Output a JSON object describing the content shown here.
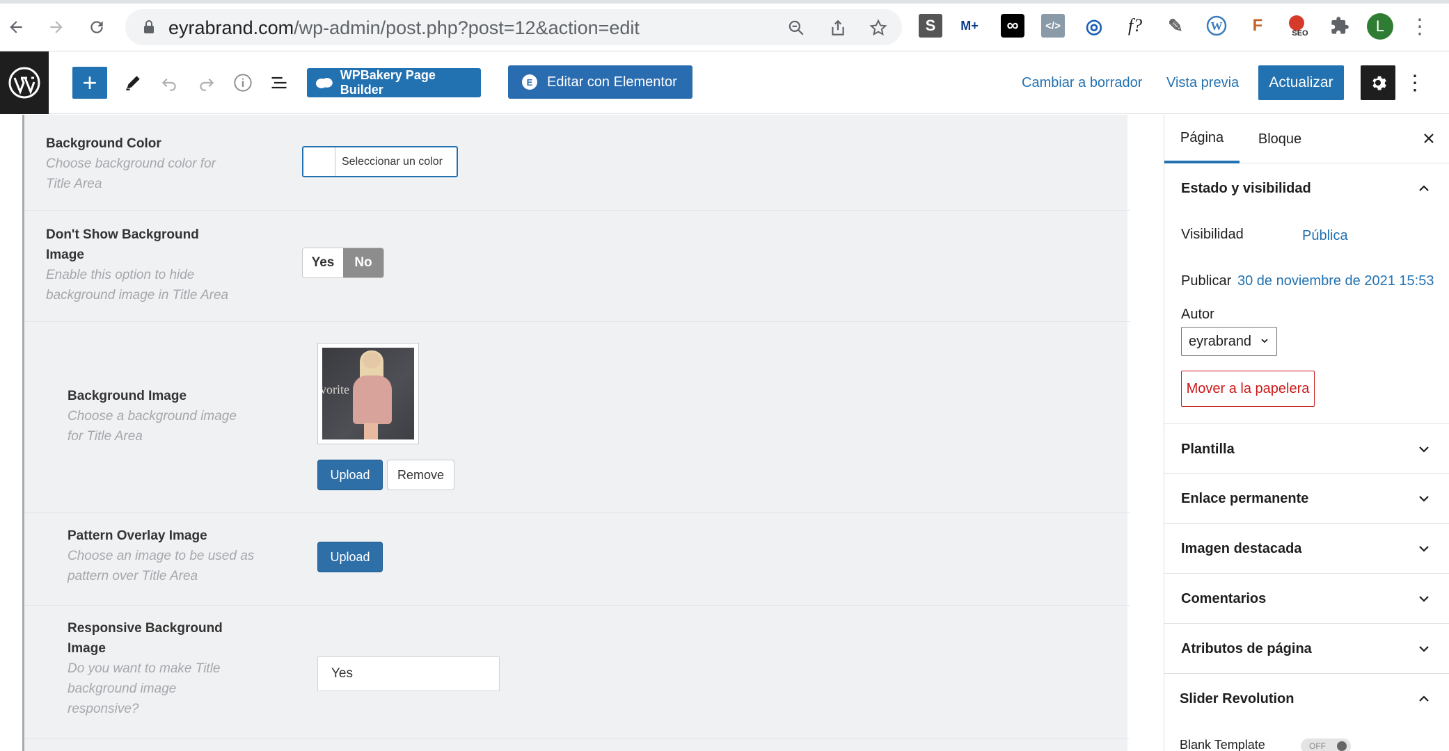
{
  "browser": {
    "url_host": "eyrabrand.com",
    "url_path": "/wp-admin/post.php?post=12&action=edit",
    "extensions": [
      "S",
      "M+",
      "∞",
      "</>",
      "◎",
      "f?",
      "✎",
      "W",
      "F",
      "SEO"
    ],
    "profile_initial": "L"
  },
  "editor_header": {
    "wpbakery_label": "WPBakery Page Builder",
    "elementor_label": "Editar con Elementor",
    "draft_label": "Cambiar a borrador",
    "preview_label": "Vista previa",
    "update_label": "Actualizar"
  },
  "metabox": {
    "bg_color": {
      "title": "Background Color",
      "desc": "Choose background color for Title Area",
      "picker_label": "Seleccionar un color"
    },
    "hide_bg": {
      "title": "Don't Show Background Image",
      "desc": "Enable this option to hide background image in Title Area",
      "yes": "Yes",
      "no": "No",
      "selected": "No"
    },
    "bg_image": {
      "title": "Background Image",
      "desc": "Choose a background image for Title Area",
      "image_text": "vorite",
      "upload": "Upload",
      "remove": "Remove"
    },
    "pattern": {
      "title": "Pattern Overlay Image",
      "desc": "Choose an image to be used as pattern over Title Area",
      "upload": "Upload"
    },
    "responsive": {
      "title": "Responsive Background Image",
      "desc": "Do you want to make Title background image responsive?",
      "value": "Yes"
    }
  },
  "sidebar": {
    "tab_page": "Página",
    "tab_block": "Bloque",
    "status_panel": {
      "title": "Estado y visibilidad",
      "visibility_label": "Visibilidad",
      "visibility_value": "Pública",
      "publish_label": "Publicar",
      "publish_value": "30 de noviembre de 2021 15:53",
      "author_label": "Autor",
      "author_value": "eyrabrand",
      "trash_label": "Mover a la papelera"
    },
    "panels": [
      "Plantilla",
      "Enlace permanente",
      "Imagen destacada",
      "Comentarios",
      "Atributos de página"
    ],
    "slider_panel": {
      "title": "Slider Revolution",
      "blank_template_label": "Blank Template",
      "toggle_text": "OFF"
    }
  },
  "colors": {
    "primary": "#2271b1",
    "danger": "#cc1818",
    "metabox_bg": "#f0f1f3"
  }
}
